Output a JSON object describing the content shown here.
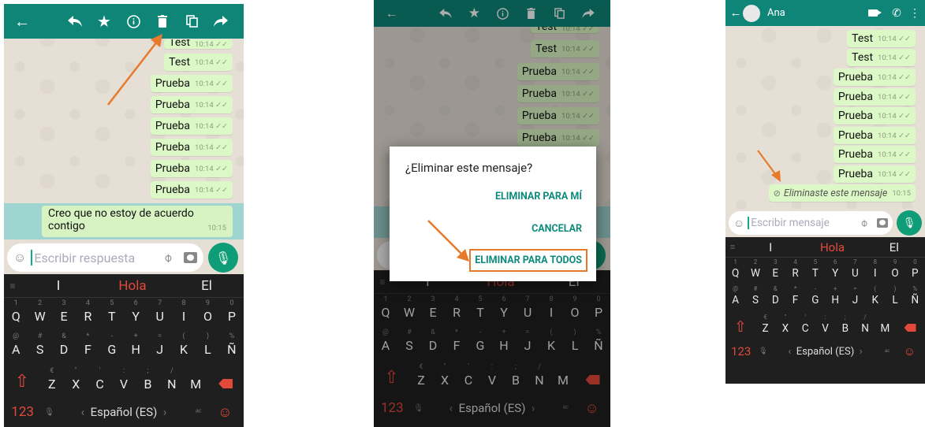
{
  "colors": {
    "header": "#0e8577",
    "bubble": "#dcf8c6",
    "selected": "#9fd5d0",
    "accent": "#0e8b7d",
    "keyboard": "#1f1f1f",
    "annotation": "#e67a2a",
    "red": "#e2493a"
  },
  "screen1": {
    "toolbar_icons": [
      "back-arrow-icon",
      "reply-icon",
      "star-icon",
      "info-icon",
      "delete-icon",
      "copy-icon",
      "forward-icon"
    ],
    "messages": [
      {
        "text": "Test",
        "time": "10:14"
      },
      {
        "text": "Test",
        "time": "10:14"
      },
      {
        "text": "Prueba",
        "time": "10:14"
      },
      {
        "text": "Prueba",
        "time": "10:14"
      },
      {
        "text": "Prueba",
        "time": "10:14"
      },
      {
        "text": "Prueba",
        "time": "10:14"
      },
      {
        "text": "Prueba",
        "time": "10:14"
      },
      {
        "text": "Prueba",
        "time": "10:14"
      }
    ],
    "selected_message": {
      "text_line1": "Creo que no estoy de acuerdo",
      "text_line2": "contigo",
      "time": "10:15"
    },
    "input_placeholder": "Escribir respuesta"
  },
  "screen2": {
    "messages": [
      {
        "text": "Test",
        "time": "10:14"
      },
      {
        "text": "Test",
        "time": "10:14"
      },
      {
        "text": "Prueba",
        "time": "10:14"
      },
      {
        "text": "Prueba",
        "time": "10:14"
      },
      {
        "text": "Prueba",
        "time": "10:14"
      },
      {
        "text": "Prueba",
        "time": "10:14"
      }
    ],
    "dialog": {
      "title": "¿Eliminar este mensaje?",
      "delete_for_me": "ELIMINAR PARA MÍ",
      "cancel": "CANCELAR",
      "delete_for_all": "ELIMINAR PARA TODOS"
    }
  },
  "screen3": {
    "contact_name": "Ana",
    "messages": [
      {
        "text": "Test",
        "time": "10:14"
      },
      {
        "text": "Test",
        "time": "10:14"
      },
      {
        "text": "Prueba",
        "time": "10:14"
      },
      {
        "text": "Prueba",
        "time": "10:14"
      },
      {
        "text": "Prueba",
        "time": "10:14"
      },
      {
        "text": "Prueba",
        "time": "10:14"
      },
      {
        "text": "Prueba",
        "time": "10:14"
      },
      {
        "text": "Prueba",
        "time": "10:14"
      }
    ],
    "deleted_notice": {
      "text": "Eliminaste este mensaje",
      "time": "10:15"
    },
    "input_placeholder": "Escribir mensaje"
  },
  "keyboard": {
    "suggestions": [
      "I",
      "Hola",
      "El"
    ],
    "row1_digits": [
      "1",
      "2",
      "3",
      "4",
      "5",
      "6",
      "7",
      "8",
      "9",
      "0"
    ],
    "row1": [
      "Q",
      "W",
      "E",
      "R",
      "T",
      "Y",
      "U",
      "I",
      "O",
      "P"
    ],
    "row2_symbols": [
      "@",
      "#",
      "&",
      "*",
      "-",
      "+",
      "=",
      "(",
      ")",
      "%"
    ],
    "row2": [
      "A",
      "S",
      "D",
      "F",
      "G",
      "H",
      "J",
      "K",
      "L",
      "Ñ"
    ],
    "row3_symbols": [
      "€",
      "\"",
      "'",
      ":",
      ";",
      "/"
    ],
    "row3": [
      "Z",
      "X",
      "C",
      "V",
      "B",
      "N",
      "M"
    ],
    "numbers_key": "123",
    "language": "Español (ES)"
  }
}
